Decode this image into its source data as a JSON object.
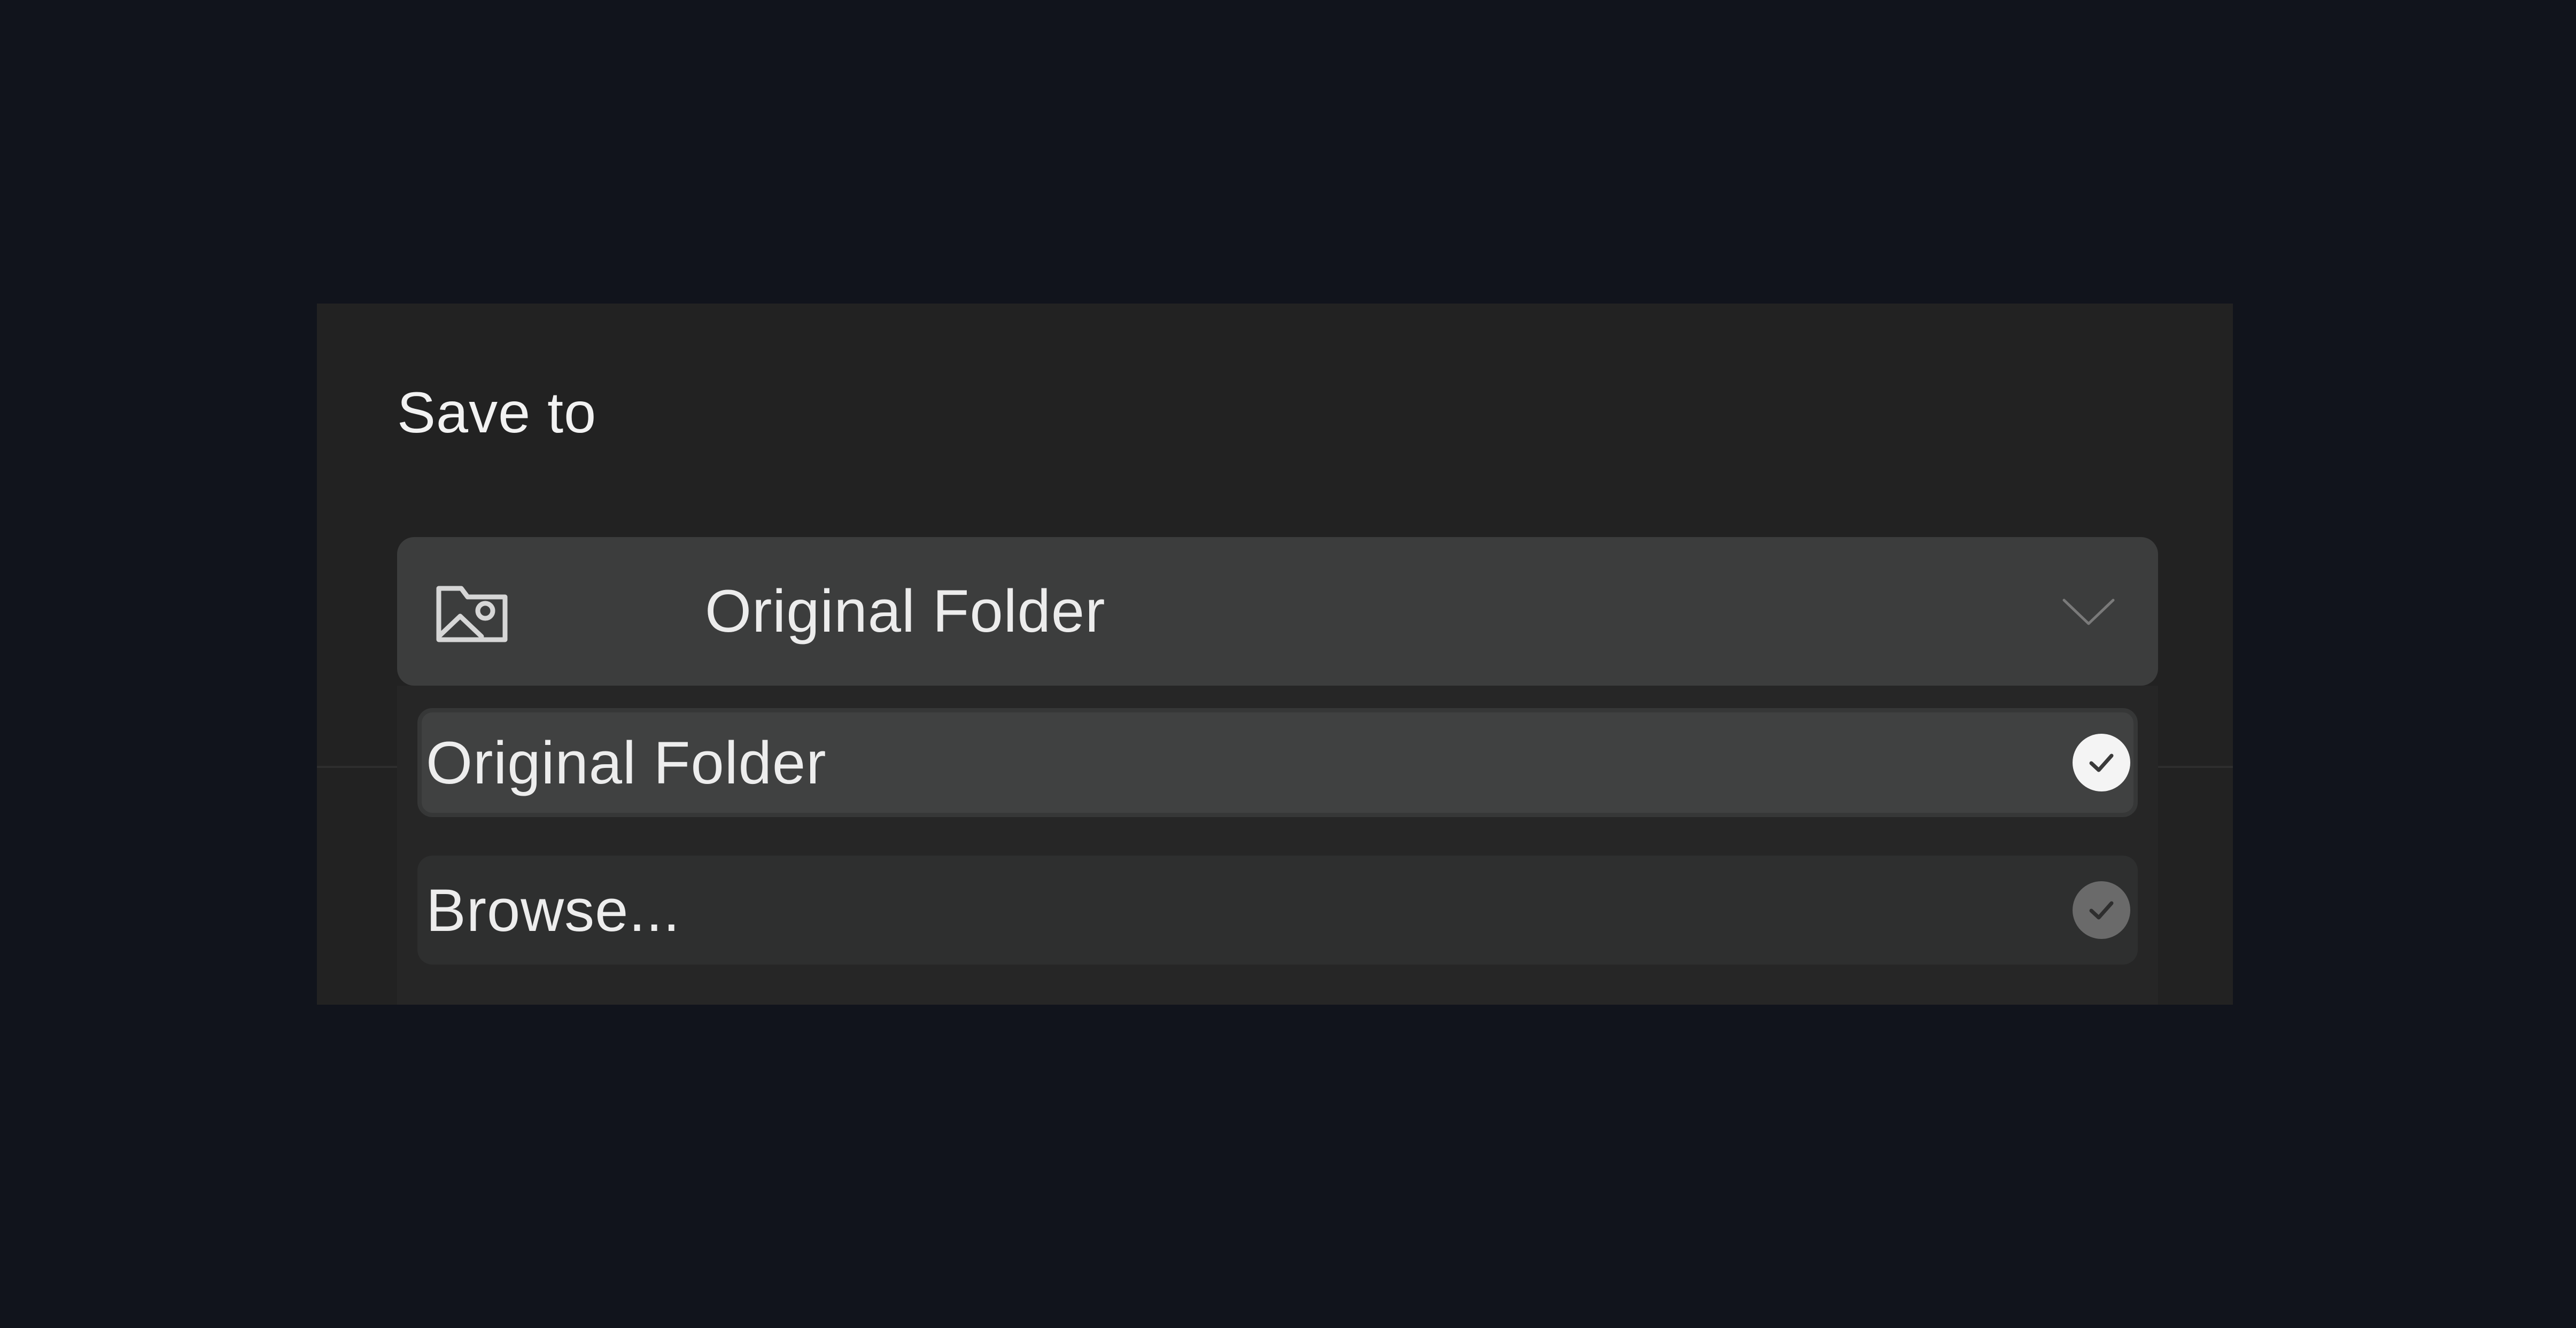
{
  "dialog": {
    "title": "Save to",
    "dropdown": {
      "icon": "folder-image-icon",
      "selected_value": "Original Folder",
      "chevron_icon": "chevron-down-icon",
      "expanded": true
    },
    "options": [
      {
        "label": "Original Folder",
        "selected": true,
        "icon": "check-circle-icon"
      },
      {
        "label": "Browse...",
        "selected": false,
        "icon": "check-circle-icon"
      }
    ]
  },
  "colors": {
    "background": "#11141c",
    "panel": "#222222",
    "dropdown": "#3c3d3d",
    "option_selected": "#404141",
    "option_normal": "#2e2f2f",
    "check_on": "#f4f4f4",
    "check_off": "#6a6a6a"
  }
}
